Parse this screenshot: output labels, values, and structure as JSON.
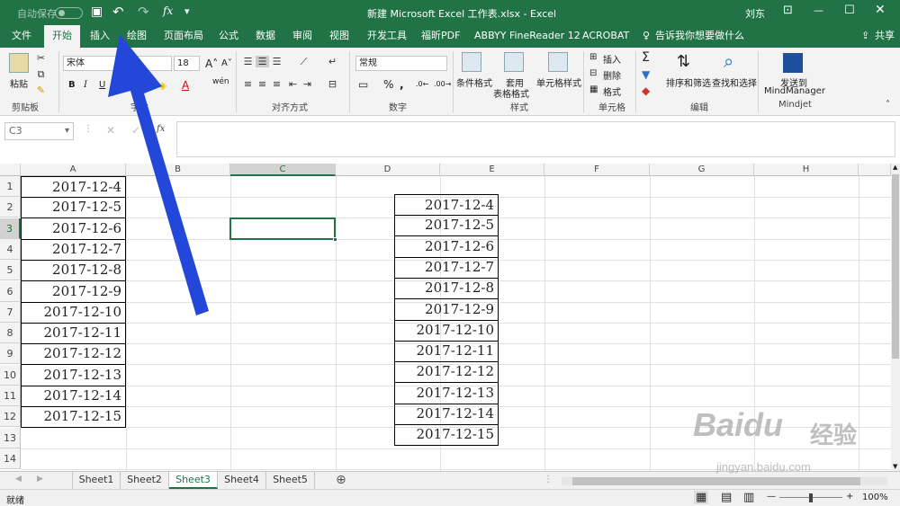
{
  "colors": {
    "excel_green": "#217346",
    "arrow": "#2347d8"
  },
  "titlebar": {
    "autosave": "自动保存",
    "off": "关",
    "doc_title": "新建 Microsoft Excel 工作表.xlsx  -  Excel",
    "user": "刘东",
    "qa_fx": "fx"
  },
  "tabs": [
    "文件",
    "开始",
    "插入",
    "绘图",
    "页面布局",
    "公式",
    "数据",
    "审阅",
    "视图",
    "开发工具",
    "福昕PDF",
    "ABBYY FineReader 12",
    "ACROBAT"
  ],
  "tellme": "告诉我你想要做什么",
  "share": "共享",
  "ribbon": {
    "paste": "粘贴",
    "clipboard": "剪贴板",
    "font_name": "宋体",
    "font_size": "18",
    "font_group": "字体",
    "align_group": "对齐方式",
    "number_format": "常规",
    "number_group": "数字",
    "cond_format": "条件格式",
    "table_format_1": "套用",
    "table_format_2": "表格格式",
    "cell_styles": "单元格样式",
    "styles_group": "样式",
    "insert": "插入",
    "delete": "删除",
    "format": "格式",
    "cells_group": "单元格",
    "sort_filter": "排序和筛选",
    "find_select": "查找和选择",
    "edit_group": "编辑",
    "send_to": "发送到",
    "mindmanager": "MindManager",
    "mindjet_group": "Mindjet"
  },
  "formula_bar": {
    "name_box": "C3",
    "fx": "fx",
    "formula": ""
  },
  "columns": [
    "A",
    "B",
    "C",
    "D",
    "E",
    "F",
    "G",
    "H"
  ],
  "rows": [
    "1",
    "2",
    "3",
    "4",
    "5",
    "6",
    "7",
    "8",
    "9",
    "10",
    "11",
    "12",
    "13",
    "14"
  ],
  "colA": [
    "2017-12-4",
    "2017-12-5",
    "2017-12-6",
    "2017-12-7",
    "2017-12-8",
    "2017-12-9",
    "2017-12-10",
    "2017-12-11",
    "2017-12-12",
    "2017-12-13",
    "2017-12-14",
    "2017-12-15"
  ],
  "colE": [
    "2017-12-4",
    "2017-12-5",
    "2017-12-6",
    "2017-12-7",
    "2017-12-8",
    "2017-12-9",
    "2017-12-10",
    "2017-12-11",
    "2017-12-12",
    "2017-12-13",
    "2017-12-14",
    "2017-12-15"
  ],
  "sheets": [
    "Sheet1",
    "Sheet2",
    "Sheet3",
    "Sheet4",
    "Sheet5"
  ],
  "active_sheet": "Sheet3",
  "status": {
    "ready": "就绪",
    "zoom": "100%"
  },
  "watermark": {
    "brand": "Baidu",
    "jingyan": "经验",
    "url": "jingyan.baidu.com"
  }
}
